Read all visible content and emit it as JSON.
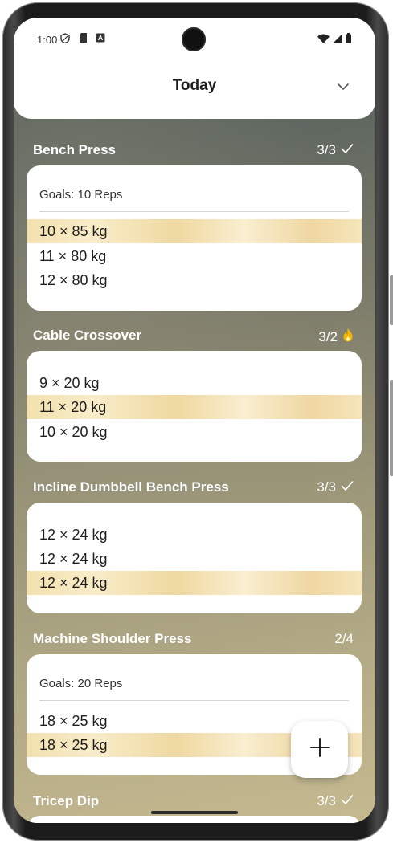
{
  "status_bar": {
    "time": "1:00",
    "left_icons": [
      "shield-icon",
      "sd-card-icon",
      "app-a-icon"
    ],
    "right_icons": [
      "wifi-icon",
      "signal-icon",
      "battery-icon"
    ]
  },
  "header": {
    "title": "Today",
    "chevron_icon": "chevron-down-icon"
  },
  "exercises": [
    {
      "name": "Bench Press",
      "count": "3/3",
      "status_icon": "check-icon",
      "goals": "Goals: 10 Reps",
      "sets": [
        {
          "text": "10 × 85 kg",
          "highlighted": true
        },
        {
          "text": "11 × 80 kg",
          "highlighted": false
        },
        {
          "text": "12 × 80 kg",
          "highlighted": false
        }
      ]
    },
    {
      "name": "Cable Crossover",
      "count": "3/2",
      "status_icon": "flame-icon",
      "sets": [
        {
          "text": "9 × 20 kg",
          "highlighted": false
        },
        {
          "text": "11 × 20 kg",
          "highlighted": true
        },
        {
          "text": "10 × 20 kg",
          "highlighted": false
        }
      ]
    },
    {
      "name": "Incline Dumbbell Bench Press",
      "count": "3/3",
      "status_icon": "check-icon",
      "sets": [
        {
          "text": "12 × 24 kg",
          "highlighted": false
        },
        {
          "text": "12 × 24 kg",
          "highlighted": false
        },
        {
          "text": "12 × 24 kg",
          "highlighted": true
        }
      ]
    },
    {
      "name": "Machine Shoulder Press",
      "count": "2/4",
      "status_icon": "",
      "goals": "Goals: 20 Reps",
      "sets": [
        {
          "text": "18 × 25 kg",
          "highlighted": false
        },
        {
          "text": "18 × 25 kg",
          "highlighted": true
        }
      ]
    },
    {
      "name": "Tricep Dip",
      "count": "3/3",
      "status_icon": "check-icon"
    }
  ],
  "fab": {
    "icon": "plus-icon"
  },
  "colors": {
    "highlight": "#f3e1ae",
    "flame": "#f2b705",
    "card": "#ffffff"
  }
}
